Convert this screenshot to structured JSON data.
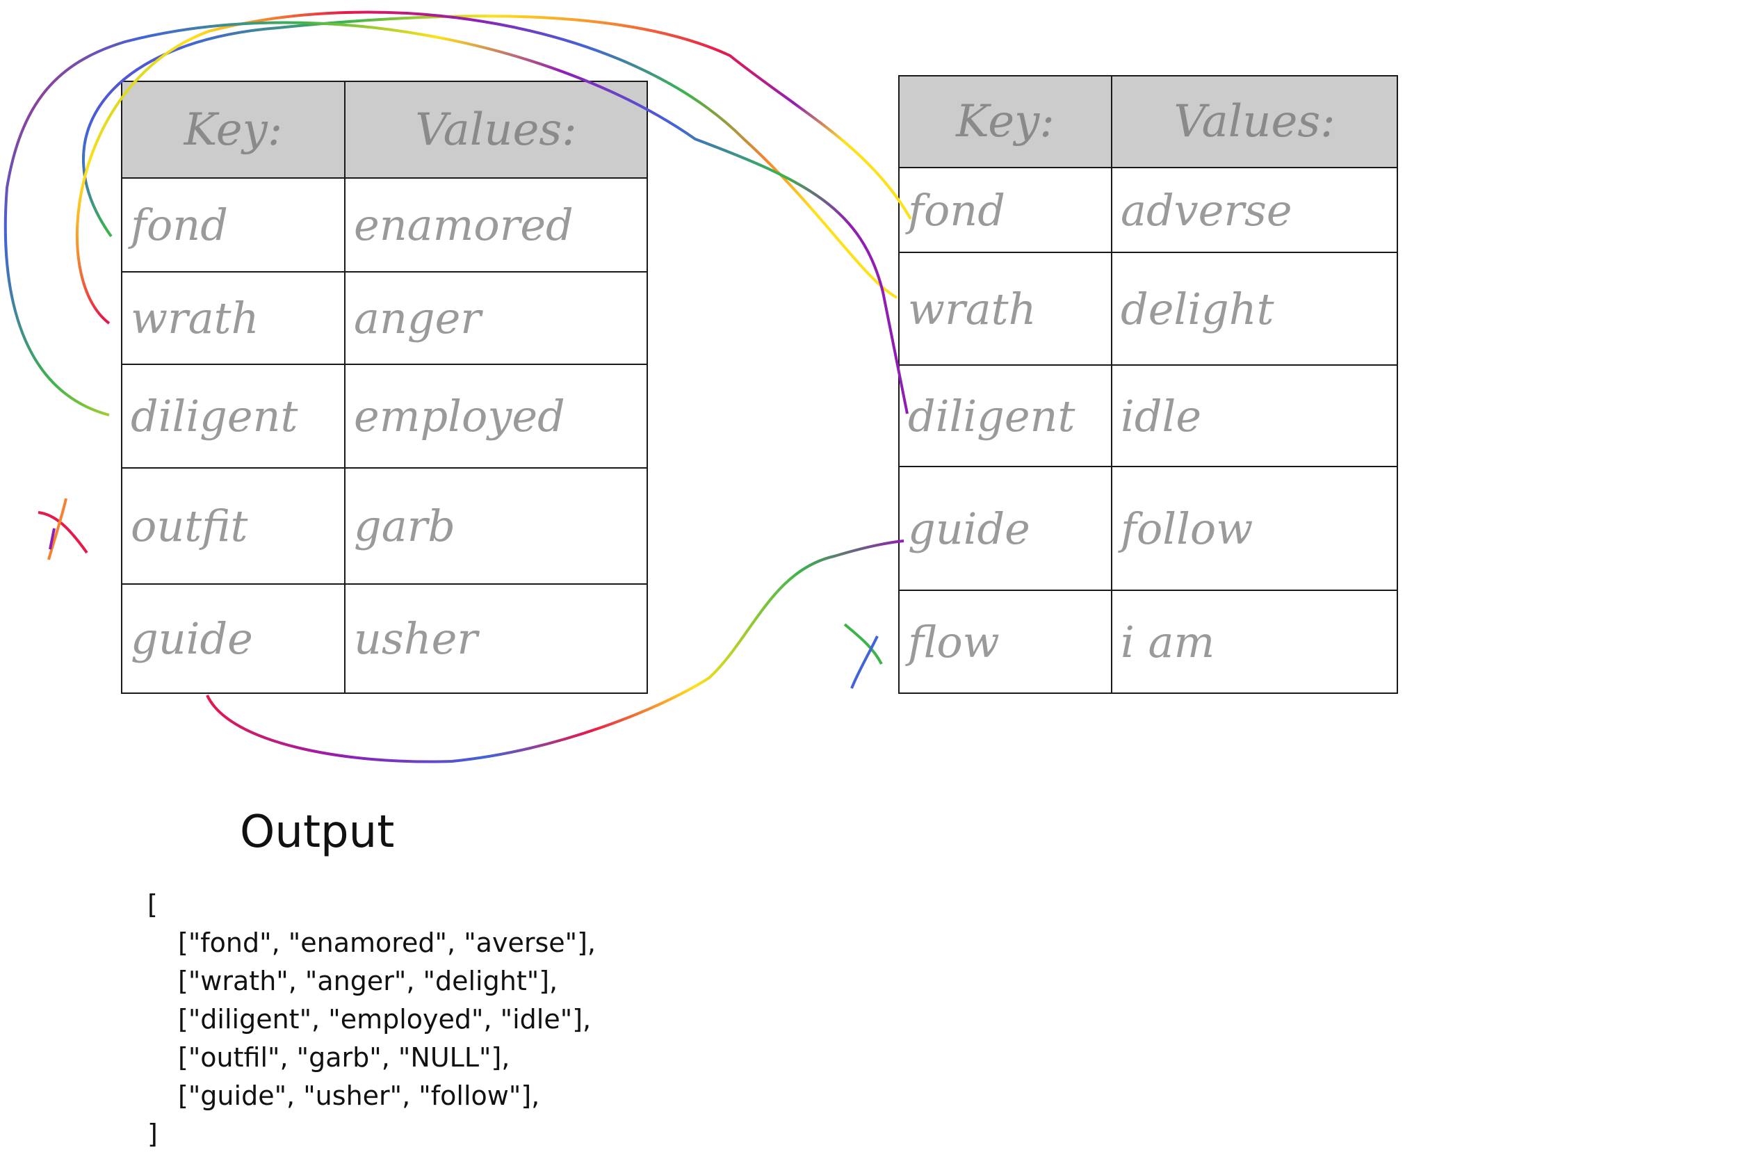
{
  "left_table": {
    "key_header": "Key:",
    "value_header": "Values:",
    "rows": [
      {
        "key": "fond",
        "value": "enamored"
      },
      {
        "key": "wrath",
        "value": "anger"
      },
      {
        "key": "diligent",
        "value": "employed"
      },
      {
        "key": "outfit",
        "value": "garb"
      },
      {
        "key": "guide",
        "value": "usher"
      }
    ]
  },
  "right_table": {
    "key_header": "Key:",
    "value_header": "Values:",
    "rows": [
      {
        "key": "fond",
        "value": "adverse"
      },
      {
        "key": "wrath",
        "value": "delight"
      },
      {
        "key": "diligent",
        "value": "idle"
      },
      {
        "key": "guide",
        "value": "follow"
      },
      {
        "key": "flow",
        "value": "i am"
      }
    ]
  },
  "marks": {
    "no_match_left": "X",
    "no_match_right": "X"
  },
  "output": {
    "title": "Output",
    "open_bracket": "[",
    "close_bracket": "]",
    "lines": [
      "[\"fond\", \"enamored\", \"averse\"],",
      "[\"wrath\", \"anger\", \"delight\"],",
      "[\"diligent\", \"employed\", \"idle\"],",
      "[\"outfil\", \"garb\", \"NULL\"],",
      "[\"guide\", \"usher\", \"follow\"],"
    ]
  },
  "colors": {
    "header_fill": "#cccccc",
    "grid_line": "#1a1a1a",
    "handwriting": "#9a9a9a",
    "arrow_gradient": [
      "#e6194b",
      "#f58231",
      "#ffe119",
      "#3cb44b",
      "#4363d8",
      "#911eb4"
    ]
  }
}
